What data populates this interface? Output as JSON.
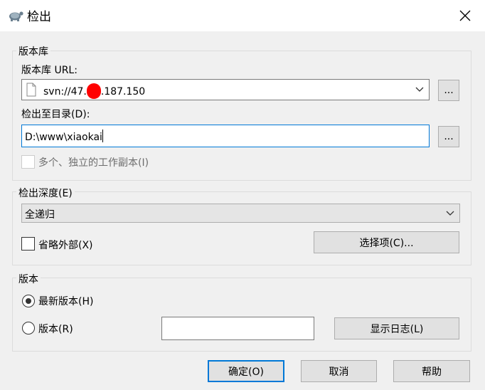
{
  "window": {
    "title": "检出"
  },
  "repository": {
    "group_label": "版本库",
    "url_label": "版本库 URL:",
    "url_value": "svn://47.",
    "url_value_end": ".187.150",
    "browse_label": "...",
    "checkout_dir_label": "检出至目录(D):",
    "checkout_dir_value": "D:\\www\\xiaokai",
    "browse_dir_label": "...",
    "multiple_copies_label": "多个、独立的工作副本(I)"
  },
  "depth": {
    "group_label": "检出深度(E)",
    "selected": "全递归",
    "omit_externals_label": "省略外部(X)",
    "choose_items_label": "选择项(C)..."
  },
  "revision": {
    "group_label": "版本",
    "head_label": "最新版本(H)",
    "revision_label": "版本(R)",
    "revision_value": "",
    "show_log_label": "显示日志(L)"
  },
  "buttons": {
    "ok": "确定(O)",
    "cancel": "取消",
    "help": "帮助"
  },
  "colors": {
    "accent": "#0078d7",
    "redaction": "#ff0000",
    "client_bg": "#f0f0f0"
  }
}
